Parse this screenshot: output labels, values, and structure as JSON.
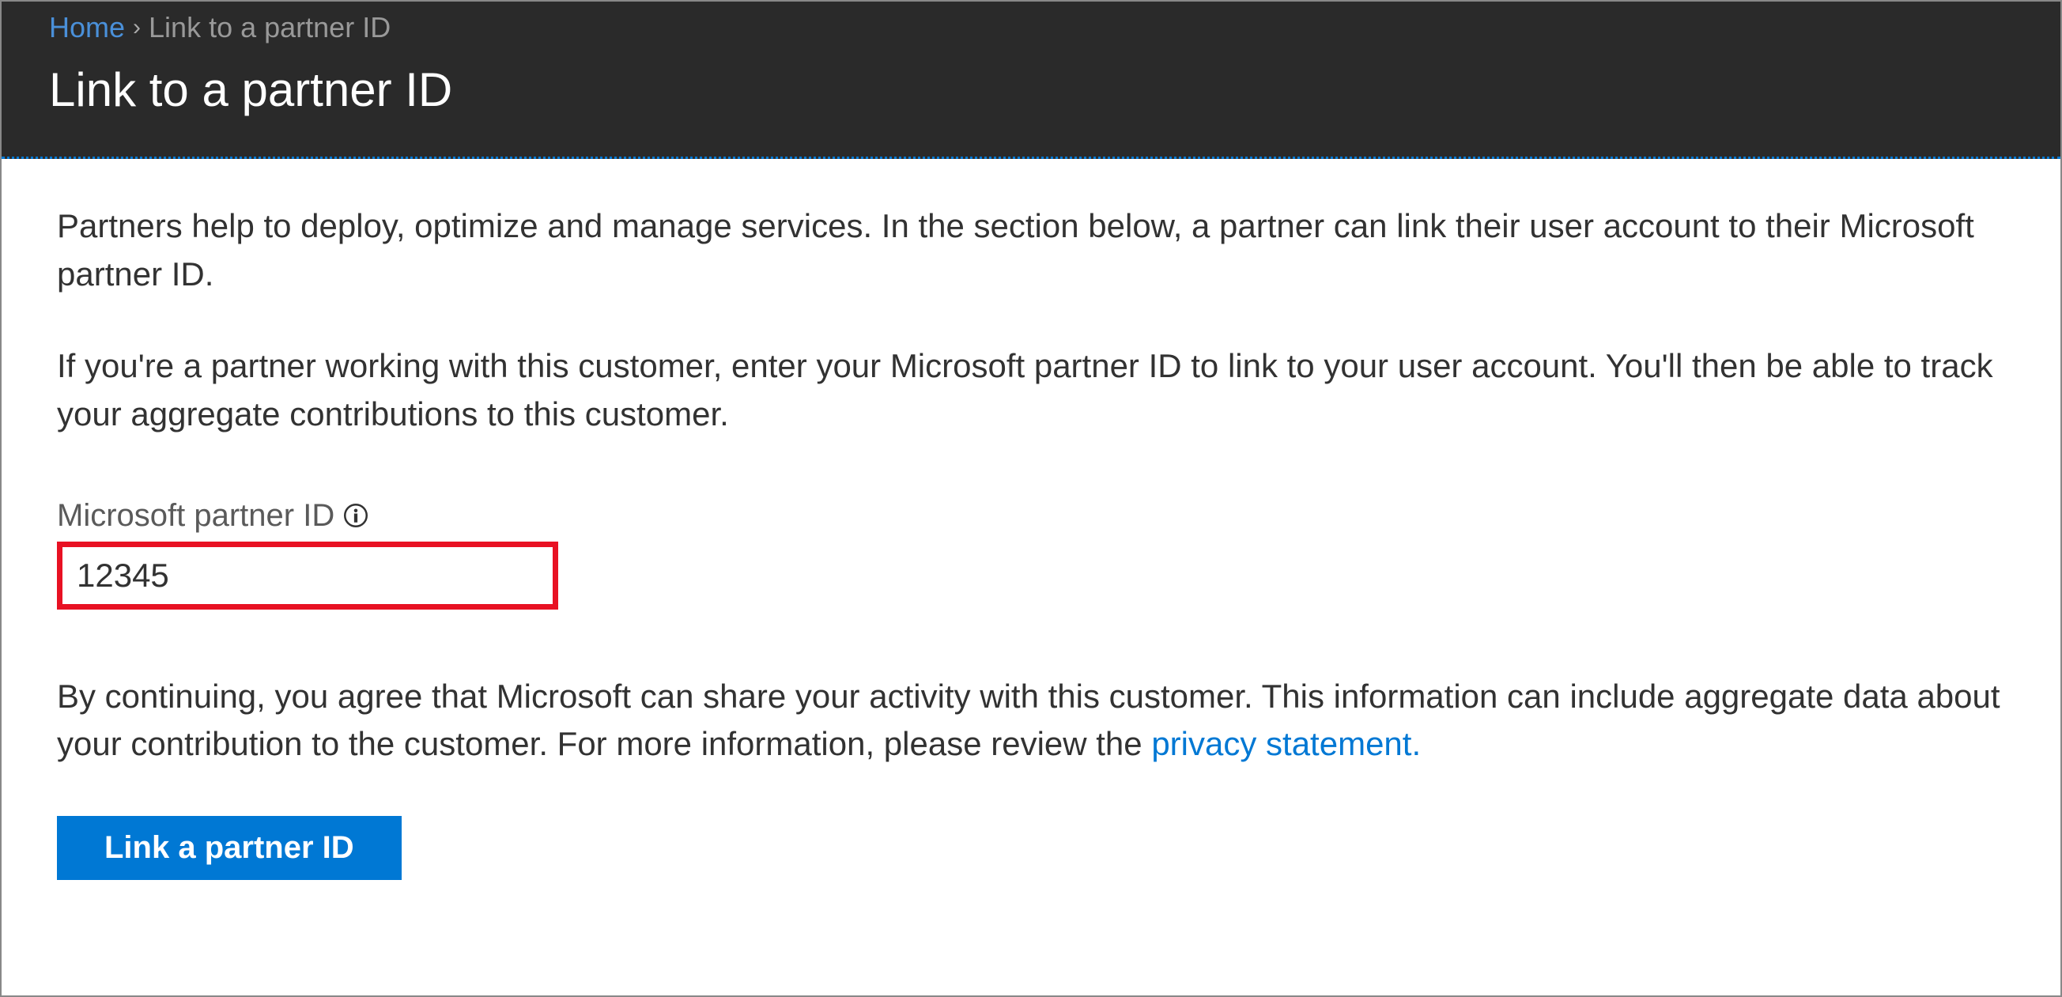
{
  "breadcrumb": {
    "home": "Home",
    "current": "Link to a partner ID"
  },
  "page_title": "Link to a partner ID",
  "content": {
    "intro_paragraph_1": "Partners help to deploy, optimize and manage services. In the section below, a partner can link their user account to their Microsoft partner ID.",
    "intro_paragraph_2": "If you're a partner working with this customer, enter your Microsoft partner ID to link to your user account. You'll then be able to track your aggregate contributions to this customer.",
    "field_label": "Microsoft partner ID",
    "partner_id_value": "12345",
    "agreement_prefix": "By continuing, you agree that Microsoft can share your activity with this customer. This information can include aggregate data about your contribution to the customer. For more information, please review the ",
    "privacy_link_text": "privacy statement.",
    "button_label": "Link a partner ID"
  },
  "colors": {
    "accent_blue": "#0078d4",
    "link_blue": "#4a90d9",
    "highlight_red": "#e81123",
    "header_bg": "#2a2a2a"
  }
}
